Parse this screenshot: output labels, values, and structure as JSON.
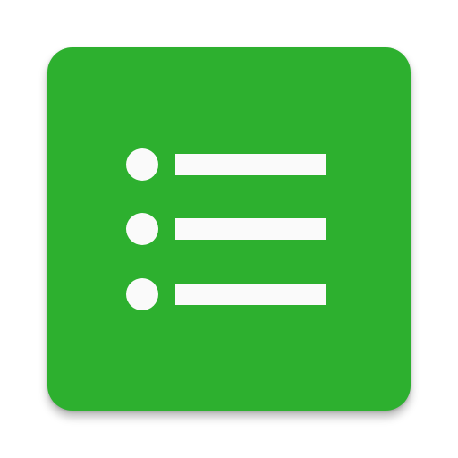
{
  "app_icon": {
    "icon_name": "bulleted-list-icon",
    "background_color": "#2db02f",
    "glyph_color": "#fafafa",
    "rows": [
      {
        "name": "row-1"
      },
      {
        "name": "row-2"
      },
      {
        "name": "row-3"
      }
    ]
  }
}
